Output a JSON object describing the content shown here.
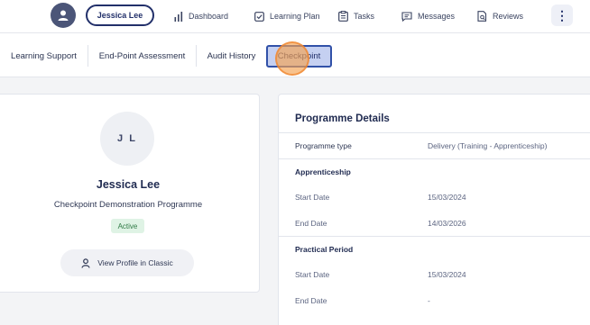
{
  "topnav": {
    "user_name": "Jessica Lee",
    "items": [
      {
        "label": "Dashboard",
        "icon": "bar-chart-icon"
      },
      {
        "label": "Learning Plan",
        "icon": "checkbox-icon"
      },
      {
        "label": "Tasks",
        "icon": "clipboard-icon"
      },
      {
        "label": "Messages",
        "icon": "chat-icon"
      },
      {
        "label": "Reviews",
        "icon": "document-search-icon"
      }
    ],
    "more_icon": "kebab-icon"
  },
  "tabs": [
    {
      "label": "Learning Support",
      "active": false
    },
    {
      "label": "End-Point Assessment",
      "active": false
    },
    {
      "label": "Audit History",
      "active": false
    },
    {
      "label": "Checkpoint",
      "active": true
    }
  ],
  "profile": {
    "initials": "J L",
    "name": "Jessica Lee",
    "programme": "Checkpoint Demonstration Programme",
    "status": "Active",
    "view_button": "View Profile in Classic"
  },
  "programme_details": {
    "title": "Programme Details",
    "programme_type_label": "Programme type",
    "programme_type_value": "Delivery (Training - Apprenticeship)",
    "apprenticeship": {
      "heading": "Apprenticeship",
      "start_label": "Start Date",
      "start_value": "15/03/2024",
      "end_label": "End Date",
      "end_value": "14/03/2026"
    },
    "practical_period": {
      "heading": "Practical Period",
      "start_label": "Start Date",
      "start_value": "15/03/2024",
      "end_label": "End Date",
      "end_value": "-"
    }
  },
  "colors": {
    "brand_navy": "#22306a",
    "active_tab_bg": "#c5d0f1",
    "status_green": "#2f7a45",
    "click_marker": "#f4a150"
  }
}
